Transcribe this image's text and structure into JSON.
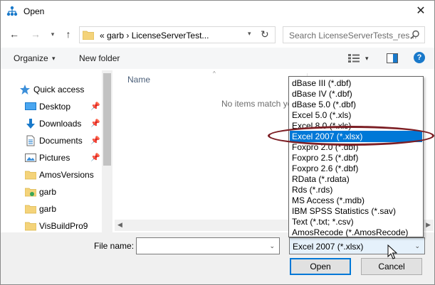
{
  "window": {
    "title": "Open",
    "close_glyph": "✕"
  },
  "nav": {
    "back_glyph": "←",
    "forward_glyph": "→",
    "recent_glyph": "▾",
    "up_glyph": "↑",
    "address_text": "«  garb  ›  LicenseServerTest...",
    "address_dd_glyph": "▾",
    "refresh_glyph": "↻",
    "search_placeholder": "Search LicenseServerTests_res..."
  },
  "toolbar": {
    "organize_label": "Organize",
    "organize_dd_glyph": "▾",
    "new_folder_label": "New folder",
    "view_dd_glyph": "▾",
    "help_label": "?"
  },
  "navpane": {
    "pin_glyph": "📌",
    "items": [
      {
        "label": "Quick access",
        "icon": "star-icon",
        "pinned": false
      },
      {
        "label": "Desktop",
        "icon": "desktop-icon",
        "pinned": true
      },
      {
        "label": "Downloads",
        "icon": "download-icon",
        "pinned": true
      },
      {
        "label": "Documents",
        "icon": "documents-icon",
        "pinned": true
      },
      {
        "label": "Pictures",
        "icon": "pictures-icon",
        "pinned": true
      },
      {
        "label": "AmosVersions",
        "icon": "folder-icon",
        "pinned": false
      },
      {
        "label": "garb",
        "icon": "folder-green-icon",
        "pinned": false
      },
      {
        "label": "garb",
        "icon": "folder-icon",
        "pinned": false
      },
      {
        "label": "VisBuildPro9",
        "icon": "folder-icon",
        "pinned": false
      }
    ]
  },
  "filelist": {
    "column_name": "Name",
    "sort_glyph": "^",
    "empty_message": "No items match yo",
    "scroll_left_glyph": "◀",
    "scroll_right_glyph": "▶"
  },
  "bottom": {
    "filename_label": "File name:",
    "filename_value": "",
    "filename_dd_glyph": "⌄",
    "filetype_selected": "Excel 2007 (*.xlsx)",
    "filetype_dd_glyph": "⌄",
    "open_label": "Open",
    "cancel_label": "Cancel"
  },
  "filetype_options": [
    "dBase III (*.dbf)",
    "dBase IV (*.dbf)",
    "dBase 5.0 (*.dbf)",
    "Excel 5.0 (*.xls)",
    "Excel 8.0 (*.xls)",
    "Excel 2007 (*.xlsx)",
    "Foxpro 2.0 (*.dbf)",
    "Foxpro 2.5 (*.dbf)",
    "Foxpro 2.6 (*.dbf)",
    "RData (*.rdata)",
    "Rds (*.rds)",
    "MS Access (*.mdb)",
    "IBM SPSS Statistics (*.sav)",
    "Text (*.txt; *.csv)",
    "AmosRecode (*.AmosRecode)"
  ],
  "selected_option_index": 5,
  "colors": {
    "selection": "#0078d7",
    "annotation": "#7c1e24",
    "folder": "#f4d37a",
    "accent_blue": "#1979ca"
  }
}
